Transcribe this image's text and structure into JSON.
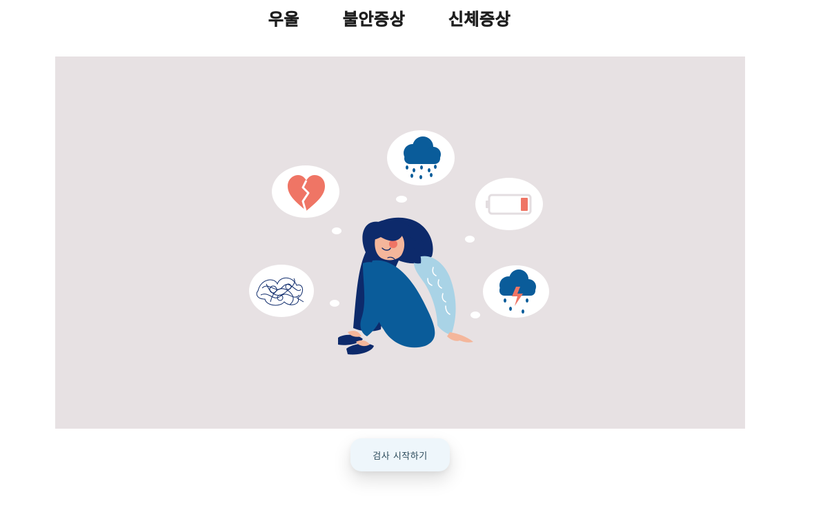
{
  "tabs": [
    {
      "label": "우울"
    },
    {
      "label": "불안증상"
    },
    {
      "label": "신체증상"
    }
  ],
  "hero": {
    "illustration": "sad-woman-with-thought-bubbles",
    "icons": [
      "broken-heart-icon",
      "rain-cloud-icon",
      "low-battery-icon",
      "tangled-thoughts-icon",
      "storm-cloud-icon"
    ],
    "colors": {
      "background": "#e7e1e3",
      "navy": "#0d2a6b",
      "blue": "#0a5c9a",
      "light_blue": "#a9d3e6",
      "coral": "#ef7565",
      "skin": "#f4b69b"
    }
  },
  "start_button": {
    "label": "검사 시작하기"
  }
}
